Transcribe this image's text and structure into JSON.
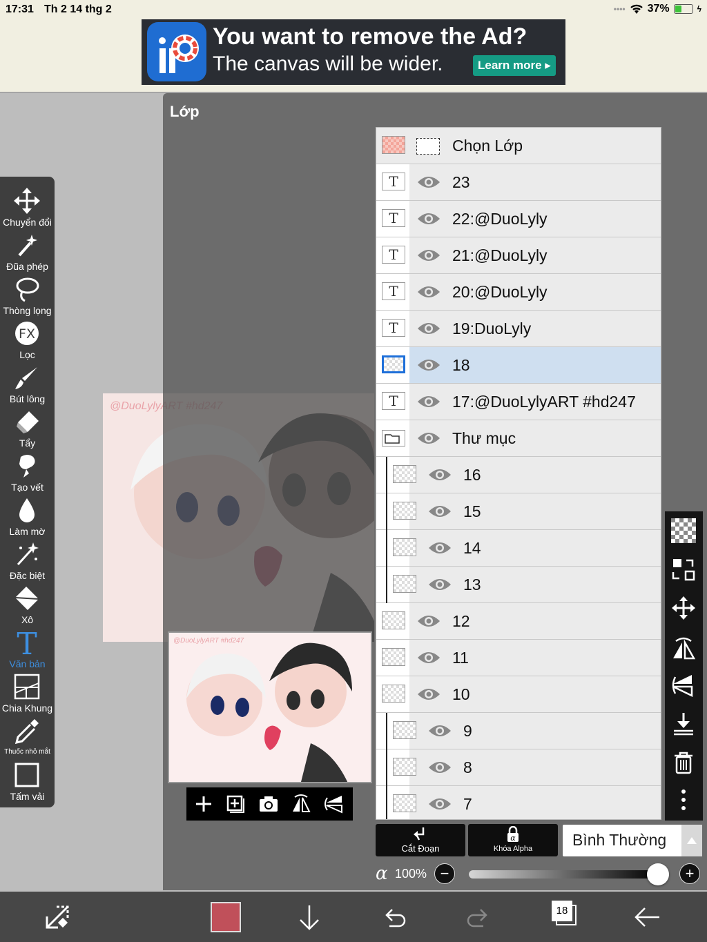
{
  "status": {
    "time": "17:31",
    "date": "Th 2 14 thg 2",
    "battery": "37%",
    "battery_level": 0.37
  },
  "ad": {
    "title": "You want to remove the Ad?",
    "subtitle": "The canvas will be wider.",
    "cta": "Learn more ▸"
  },
  "tools": [
    {
      "label": "Chuyển đổi",
      "icon": "move-icon"
    },
    {
      "label": "Đũa phép",
      "icon": "magic-wand-icon"
    },
    {
      "label": "Thòng lọng",
      "icon": "lasso-icon"
    },
    {
      "label": "Lọc",
      "icon": "fx-filter-icon"
    },
    {
      "label": "Bút lông",
      "icon": "brush-icon"
    },
    {
      "label": "Tẩy",
      "icon": "eraser-icon"
    },
    {
      "label": "Tạo vết",
      "icon": "smudge-icon"
    },
    {
      "label": "Làm mờ",
      "icon": "blur-icon"
    },
    {
      "label": "Đặc biệt",
      "icon": "special-icon"
    },
    {
      "label": "Xô",
      "icon": "bucket-icon"
    },
    {
      "label": "Văn bản",
      "icon": "text-icon",
      "active": true
    },
    {
      "label": "Chia Khung",
      "icon": "frame-divider-icon"
    },
    {
      "label": "Thuốc nhỏ mắt",
      "icon": "eyedropper-icon"
    },
    {
      "label": "Tấm vải",
      "icon": "canvas-icon"
    }
  ],
  "canvas": {
    "watermark": "@DuoLylyART #hd247"
  },
  "layer_panel": {
    "title": "Lớp",
    "select_layer": "Chọn Lớp",
    "preview_watermark": "@DuoLylyART #hd247",
    "layers": [
      {
        "name": "23",
        "kind": "text"
      },
      {
        "name": "22:@DuoLyly",
        "kind": "text"
      },
      {
        "name": "21:@DuoLyly",
        "kind": "text"
      },
      {
        "name": "20:@DuoLyly",
        "kind": "text"
      },
      {
        "name": "19:DuoLyly",
        "kind": "text"
      },
      {
        "name": "18",
        "kind": "raster",
        "selected": true
      },
      {
        "name": "17:@DuoLylyART #hd247",
        "kind": "text"
      },
      {
        "name": "Thư mục",
        "kind": "folder"
      },
      {
        "name": "16",
        "kind": "raster",
        "indent": 1
      },
      {
        "name": "15",
        "kind": "raster",
        "indent": 1
      },
      {
        "name": "14",
        "kind": "raster",
        "indent": 1
      },
      {
        "name": "13",
        "kind": "raster",
        "indent": 1
      },
      {
        "name": "12",
        "kind": "raster"
      },
      {
        "name": "11",
        "kind": "raster"
      },
      {
        "name": "10",
        "kind": "raster"
      },
      {
        "name": "9",
        "kind": "raster",
        "indent": 1
      },
      {
        "name": "8",
        "kind": "raster",
        "indent": 1
      },
      {
        "name": "7",
        "kind": "raster",
        "indent": 1
      }
    ],
    "clipping_label": "Cắt Đoạn",
    "alpha_lock_label": "Khóa Alpha",
    "blend_mode": "Bình Thường",
    "opacity_symbol": "α",
    "opacity_text": "100%",
    "opacity_value": 1.0
  },
  "bottom_bar": {
    "layer_count": "18",
    "brush_color": "#c0505a"
  }
}
